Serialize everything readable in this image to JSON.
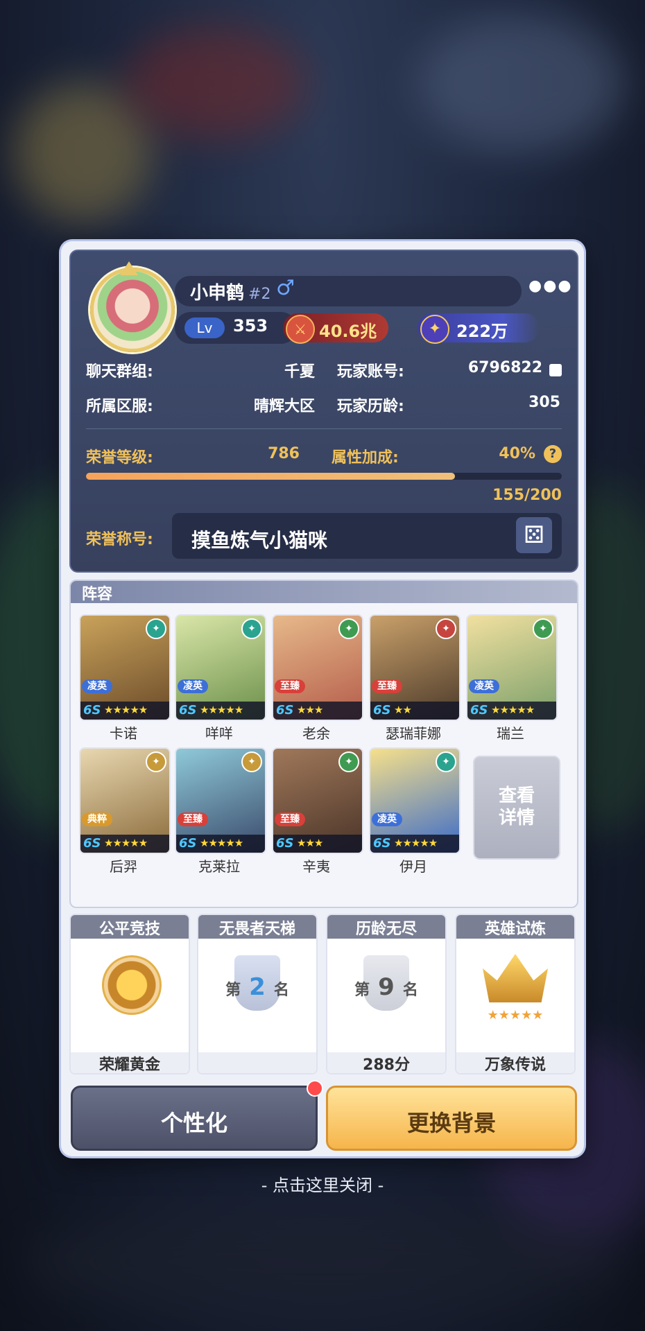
{
  "profile": {
    "name": "小申鹤",
    "number": "#2",
    "gender_icon": "♂",
    "more_icon": "●●●",
    "level_badge": "Lv",
    "level": "353",
    "power": "40.6兆",
    "gems": "222万",
    "chat_group_label": "聊天群组:",
    "chat_group": "千夏",
    "account_label": "玩家账号:",
    "account": "6796822",
    "server_label": "所属区服:",
    "server": "晴辉大区",
    "age_label": "玩家历龄:",
    "age": "305",
    "honor_level_label": "荣誉等级:",
    "honor_level": "786",
    "bonus_label": "属性加成:",
    "bonus": "40%",
    "progress_text": "155/200",
    "progress_fraction": 0.775,
    "honor_title_label": "荣誉称号:",
    "honor_title": "摸鱼炼气小猫咪"
  },
  "roster": {
    "title": "阵容",
    "grade_text": "6S",
    "heroes": [
      {
        "name": "卡诺",
        "tag": "凌英",
        "stars": "★★★★★",
        "tag_color": "#3d6fd8",
        "elem_color": "#2aa38f"
      },
      {
        "name": "咩咩",
        "tag": "凌英",
        "stars": "★★★★★",
        "tag_color": "#3d6fd8",
        "elem_color": "#2aa38f"
      },
      {
        "name": "老余",
        "tag": "至臻",
        "stars": "★★★",
        "tag_color": "#d8403a",
        "elem_color": "#3f9b52"
      },
      {
        "name": "瑟瑞菲娜",
        "tag": "至臻",
        "stars": "★★",
        "tag_color": "#d8403a",
        "elem_color": "#c6453f"
      },
      {
        "name": "瑞兰",
        "tag": "凌英",
        "stars": "★★★★★",
        "tag_color": "#3d6fd8",
        "elem_color": "#3f9b52"
      },
      {
        "name": "后羿",
        "tag": "典粹",
        "stars": "★★★★★",
        "tag_color": "#d99a2b",
        "elem_color": "#c79a3a"
      },
      {
        "name": "克莱拉",
        "tag": "至臻",
        "stars": "★★★★★",
        "tag_color": "#d8403a",
        "elem_color": "#c79a3a"
      },
      {
        "name": "辛夷",
        "tag": "至臻",
        "stars": "★★★",
        "tag_color": "#d8403a",
        "elem_color": "#3f9b52"
      },
      {
        "name": "伊月",
        "tag": "凌英",
        "stars": "★★★★★",
        "tag_color": "#3d6fd8",
        "elem_color": "#2aa38f"
      }
    ],
    "detail_button": "查看\n详情"
  },
  "modes": [
    {
      "title": "公平竞技",
      "value": "荣耀黄金"
    },
    {
      "title": "无畏者天梯",
      "rank_pre": "第",
      "rank": "2",
      "rank_post": "名",
      "value": ""
    },
    {
      "title": "历龄无尽",
      "rank_pre": "第",
      "rank": "9",
      "rank_post": "名",
      "value": "288分"
    },
    {
      "title": "英雄试炼",
      "value": "万象传说"
    }
  ],
  "buttons": {
    "personalize": "个性化",
    "change_background": "更换背景"
  },
  "close_hint": "- 点击这里关闭 -"
}
